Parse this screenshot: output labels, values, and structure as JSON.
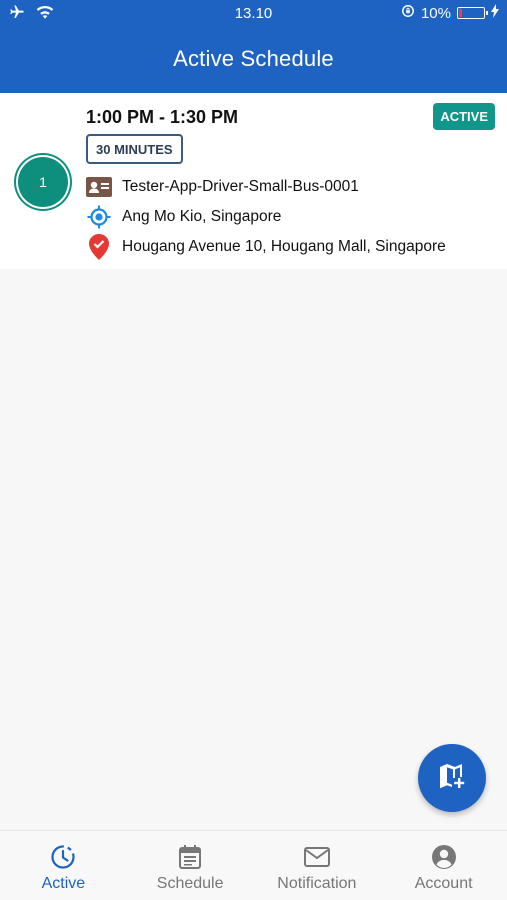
{
  "status_bar": {
    "time": "13.10",
    "battery_text": "10%",
    "battery_level": 0.1
  },
  "header": {
    "title": "Active Schedule"
  },
  "schedule": {
    "index": "1",
    "time_range": "1:00 PM - 1:30 PM",
    "status": "ACTIVE",
    "duration": "30 MINUTES",
    "driver": "Tester-App-Driver-Small-Bus-0001",
    "origin": "Ang Mo Kio, Singapore",
    "destination": "Hougang Avenue 10, Hougang Mall, Singapore"
  },
  "colors": {
    "primary": "#1e63c2",
    "active_badge": "#10968a",
    "order_circle": "#0e8f7e",
    "origin_icon": "#1e88e5",
    "destination_icon": "#e53935"
  },
  "fab": {
    "icon": "map-add-icon"
  },
  "bottom_nav": {
    "items": [
      {
        "label": "Active",
        "icon": "clock-icon",
        "active": true
      },
      {
        "label": "Schedule",
        "icon": "calendar-icon",
        "active": false
      },
      {
        "label": "Notification",
        "icon": "mail-icon",
        "active": false
      },
      {
        "label": "Account",
        "icon": "account-icon",
        "active": false
      }
    ]
  }
}
